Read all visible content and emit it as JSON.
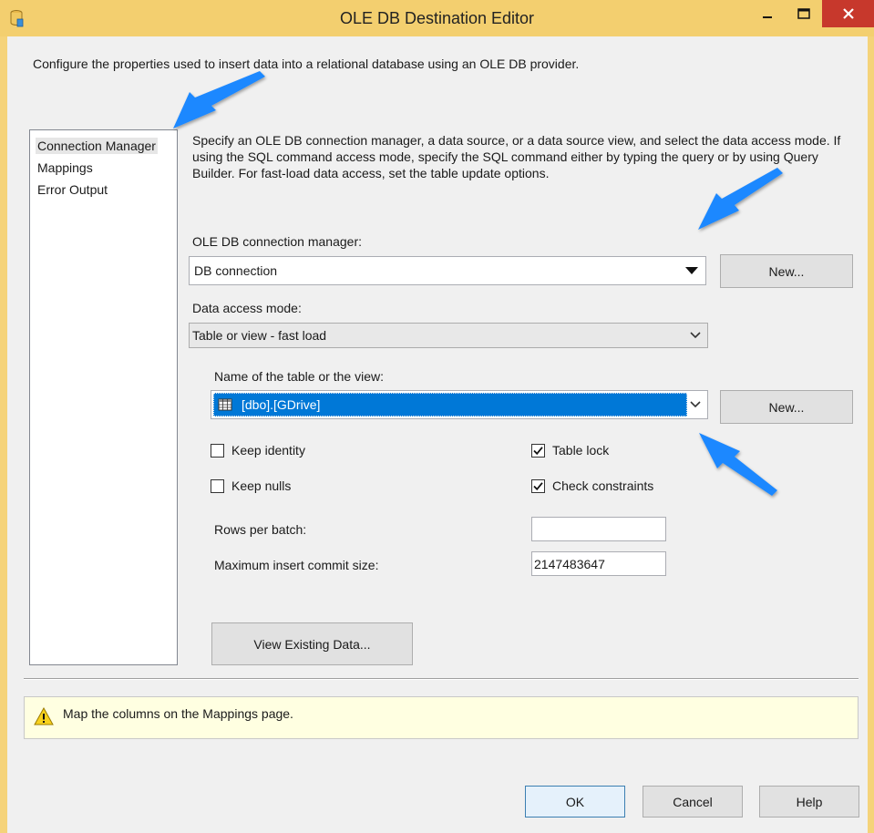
{
  "window": {
    "title": "OLE DB Destination Editor"
  },
  "description": "Configure the properties used to insert data into a relational database using an OLE DB provider.",
  "nav": {
    "items": [
      {
        "label": "Connection Manager",
        "selected": true
      },
      {
        "label": "Mappings",
        "selected": false
      },
      {
        "label": "Error Output",
        "selected": false
      }
    ]
  },
  "main": {
    "instructions": "Specify an OLE DB connection manager, a data source, or a data source view, and select the data access mode. If using the SQL command access mode, specify the SQL command either by typing the query or by using Query Builder. For fast-load data access, set the table update options.",
    "connection_manager_label": "OLE DB connection manager:",
    "connection_manager_value": "DB connection",
    "new_button_label": "New...",
    "access_mode_label": "Data access mode:",
    "access_mode_value": "Table or view - fast load",
    "table_name_label": "Name of the table or the view:",
    "table_name_value": "[dbo].[GDrive]",
    "new_table_button_label": "New...",
    "options": {
      "keep_identity": {
        "label": "Keep identity",
        "checked": false
      },
      "keep_nulls": {
        "label": "Keep nulls",
        "checked": false
      },
      "table_lock": {
        "label": "Table lock",
        "checked": true
      },
      "check_constraints": {
        "label": "Check constraints",
        "checked": true
      }
    },
    "rows_per_batch_label": "Rows per batch:",
    "rows_per_batch_value": "",
    "max_commit_label": "Maximum insert commit size:",
    "max_commit_value": "2147483647",
    "view_data_button_label": "View Existing Data..."
  },
  "message": {
    "icon": "warning-icon",
    "text": "Map the columns on the Mappings page."
  },
  "footer": {
    "ok_label": "OK",
    "cancel_label": "Cancel",
    "help_label": "Help"
  },
  "colors": {
    "titlebar": "#f3cf6f",
    "close_button": "#c7382c",
    "selection": "#0078d7",
    "annotation_arrow": "#1e88ff",
    "message_background": "#ffffe1"
  }
}
